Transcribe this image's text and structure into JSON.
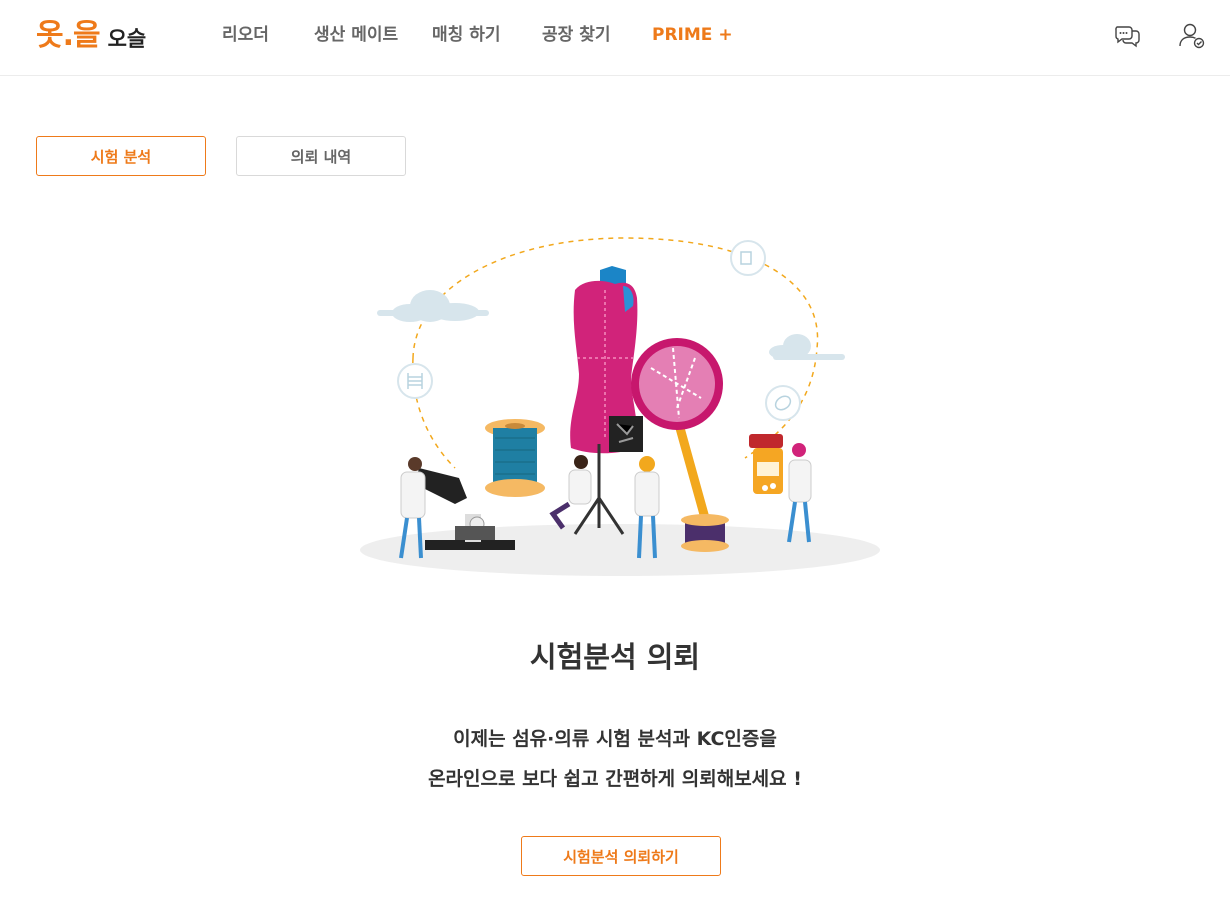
{
  "header": {
    "logo_mark": "옷.을",
    "logo_text": "오슬",
    "nav": [
      "리오더",
      "생산 메이트",
      "매칭 하기",
      "공장 찾기",
      "PRIME +"
    ],
    "icons": [
      "chat-icon",
      "user-check-icon"
    ]
  },
  "tabs": [
    {
      "label": "시험 분석",
      "active": true
    },
    {
      "label": "의뢰 내역",
      "active": false
    }
  ],
  "main": {
    "title": "시험분석 의뢰",
    "description_line1": "이제는 섬유·의류 시험 분석과 KC인증을",
    "description_line2": "온라인으로 보다 쉽고 간편하게 의뢰해보세요 !",
    "cta_label": "시험분석 의뢰하기"
  },
  "colors": {
    "accent": "#ee7a1a",
    "dress": "#d1237a",
    "spool_thread": "#1f7fa3"
  }
}
